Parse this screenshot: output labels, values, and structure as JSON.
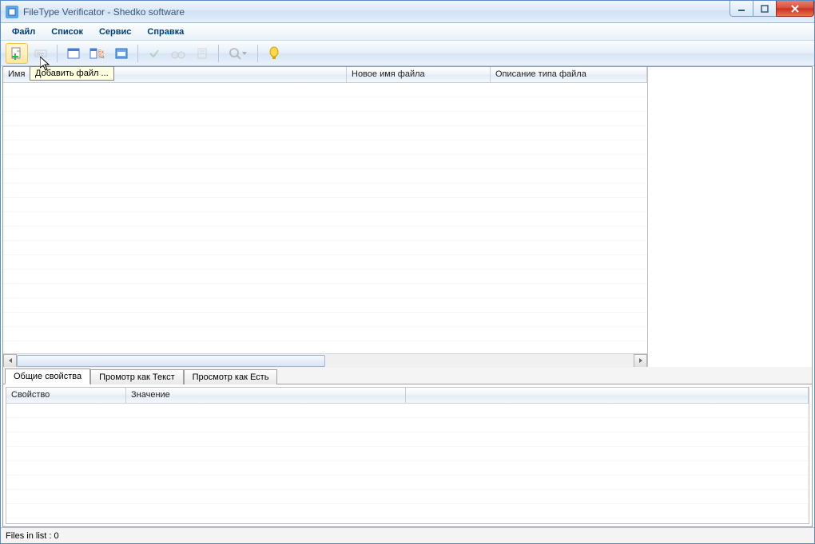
{
  "window": {
    "title": "FileType Verificator - Shedko software"
  },
  "menu": {
    "file": "Файл",
    "list": "Список",
    "service": "Сервис",
    "help": "Справка"
  },
  "toolbar": {
    "tooltip_add_file": "Добавить файл ..."
  },
  "grid": {
    "columns": {
      "name": "Имя",
      "new_name": "Новое имя файла",
      "type_desc": "Описание типа файла"
    }
  },
  "tabs": {
    "general": "Общие свойства",
    "view_text": "Промотр как Текст",
    "view_asis": "Просмотр как Есть"
  },
  "props": {
    "col_property": "Свойство",
    "col_value": "Значение"
  },
  "status": {
    "files_in_list": "Files in list : 0"
  }
}
